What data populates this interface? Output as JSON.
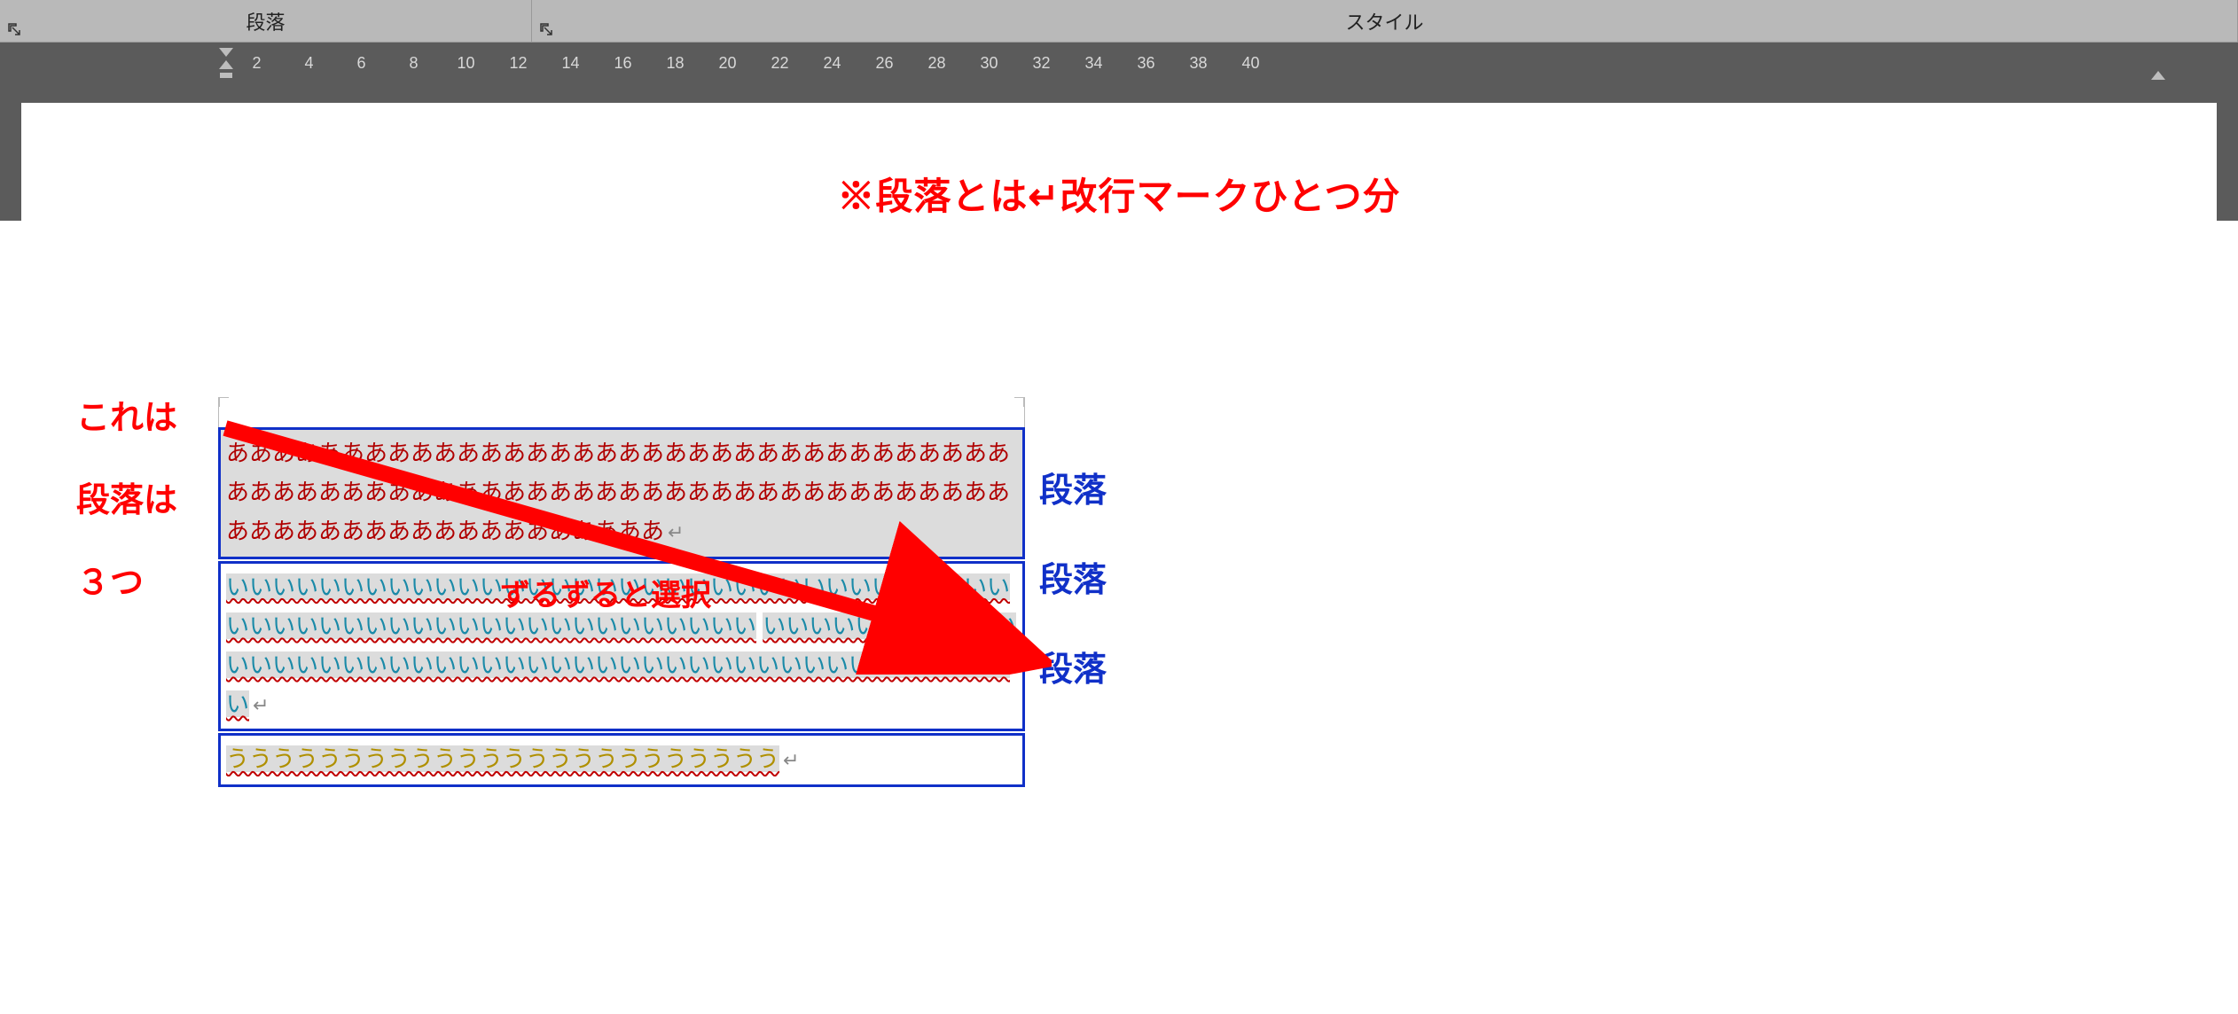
{
  "ribbon": {
    "paragraph_label": "段落",
    "style_label": "スタイル"
  },
  "ruler": {
    "numbers": [
      "2",
      "4",
      "6",
      "8",
      "10",
      "12",
      "14",
      "16",
      "18",
      "20",
      "22",
      "24",
      "26",
      "28",
      "30",
      "32",
      "34",
      "36",
      "38",
      "40"
    ]
  },
  "document": {
    "title": "※段落とは↵改行マークひとつ分",
    "left_notes": [
      "これは",
      "段落は",
      "３つ"
    ],
    "right_notes": [
      "段落",
      "段落",
      "段落"
    ],
    "arrow_label": "ずるずると選択",
    "paragraphs": {
      "p1_line1": "ああああああああああああああああああああああああああああああああああ",
      "p1_line2": "ああああああああああああああああああああああああああああああああああ",
      "p1_line3_sel": "あああああああああああああああああああ",
      "p2_line1": "いいいいいいいいいいいいいいいいいいいいいいいいいいいいいいいいいいいいいいいいいいいいいいいいいいいいいいいいい",
      "p2_line2": "いいいいいいいいいいいいいいいいいいいいいいいいいいいいいいいいいいいいいいいいいいいいいい",
      "p3_line1": "うううううううううううううううううううううううう"
    },
    "pilcrow": "↵"
  }
}
